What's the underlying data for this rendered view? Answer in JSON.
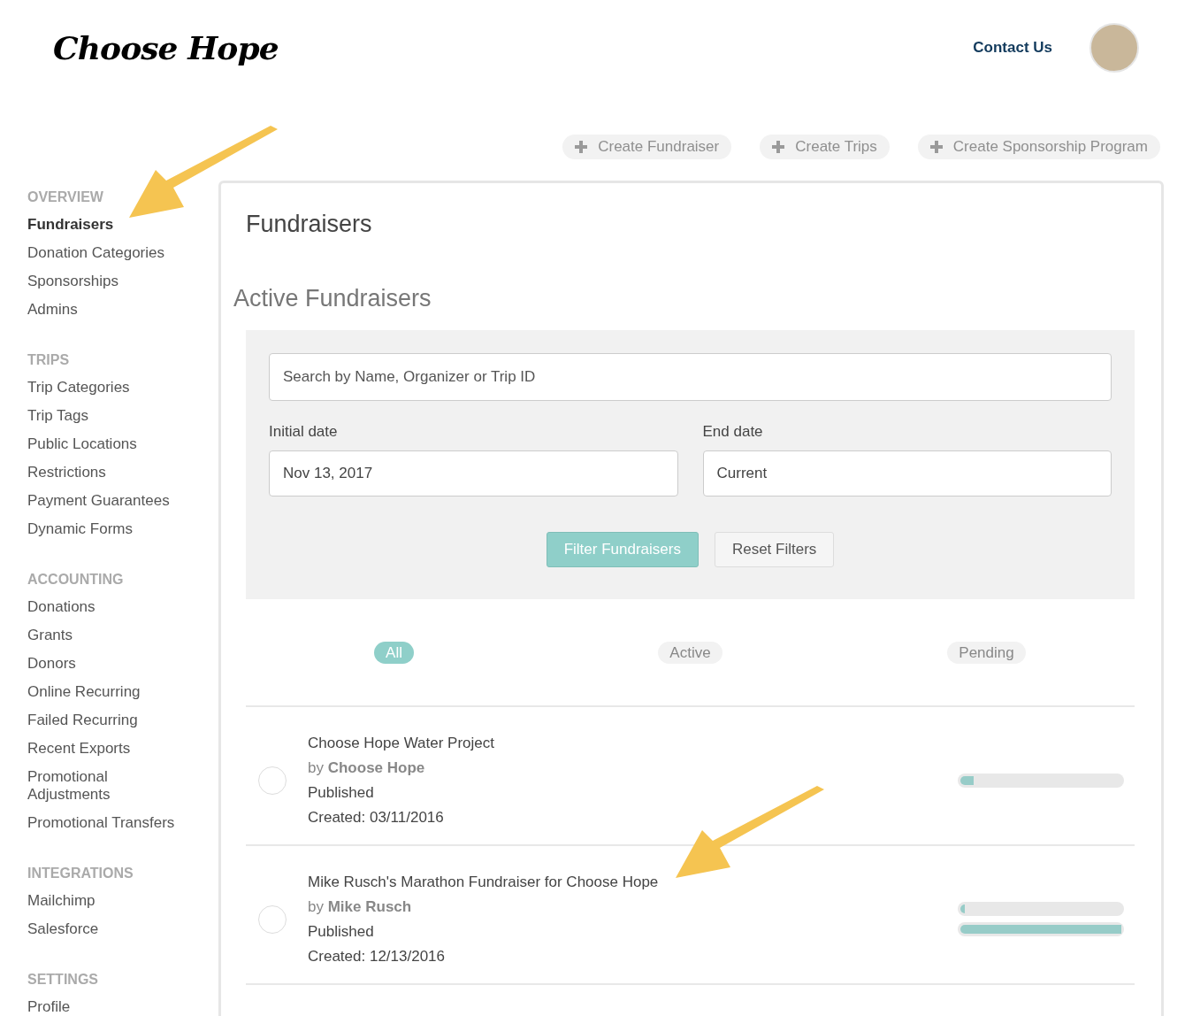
{
  "header": {
    "logo": "Choose Hope",
    "contact_link": "Contact Us"
  },
  "actions": [
    "Create Fundraiser",
    "Create Trips",
    "Create Sponsorship Program"
  ],
  "sidebar": [
    {
      "heading": "OVERVIEW",
      "items": [
        {
          "label": "Fundraisers",
          "selected": true
        },
        {
          "label": "Donation Categories",
          "selected": false
        },
        {
          "label": "Sponsorships",
          "selected": false
        },
        {
          "label": "Admins",
          "selected": false
        }
      ]
    },
    {
      "heading": "TRIPS",
      "items": [
        {
          "label": "Trip Categories",
          "selected": false
        },
        {
          "label": "Trip Tags",
          "selected": false
        },
        {
          "label": "Public Locations",
          "selected": false
        },
        {
          "label": "Restrictions",
          "selected": false
        },
        {
          "label": "Payment Guarantees",
          "selected": false
        },
        {
          "label": "Dynamic Forms",
          "selected": false
        }
      ]
    },
    {
      "heading": "ACCOUNTING",
      "items": [
        {
          "label": "Donations",
          "selected": false
        },
        {
          "label": "Grants",
          "selected": false
        },
        {
          "label": "Donors",
          "selected": false
        },
        {
          "label": "Online Recurring",
          "selected": false
        },
        {
          "label": "Failed Recurring",
          "selected": false
        },
        {
          "label": "Recent Exports",
          "selected": false
        },
        {
          "label": "Promotional Adjustments",
          "selected": false
        },
        {
          "label": "Promotional Transfers",
          "selected": false
        }
      ]
    },
    {
      "heading": "INTEGRATIONS",
      "items": [
        {
          "label": "Mailchimp",
          "selected": false
        },
        {
          "label": "Salesforce",
          "selected": false
        }
      ]
    },
    {
      "heading": "SETTINGS",
      "items": [
        {
          "label": "Profile",
          "selected": false
        }
      ]
    }
  ],
  "page_title": "Fundraisers",
  "section_title": "Active Fundraisers",
  "filters": {
    "search": {
      "placeholder": "Search by Name, Organizer or Trip ID"
    },
    "initial_date": {
      "label": "Initial date",
      "value": "Nov 13, 2017"
    },
    "end_date": {
      "label": "End date",
      "value": "Current"
    },
    "buttons": [
      {
        "label": "Filter Fundraisers",
        "kind": "primary"
      },
      {
        "label": "Reset Filters",
        "kind": "secondary"
      }
    ]
  },
  "status_tabs": [
    {
      "label": "All",
      "selected": true
    },
    {
      "label": "Active",
      "selected": false
    },
    {
      "label": "Pending",
      "selected": false
    }
  ],
  "fundraisers": [
    {
      "title": "Choose Hope Water Project",
      "by": "by",
      "organizer": "Choose Hope",
      "status": "Published",
      "created": "Created: 03/11/2016",
      "bars": [
        {
          "level": 0.08
        }
      ]
    },
    {
      "title": "Mike Rusch's Marathon Fundraiser for Choose Hope",
      "by": "by",
      "organizer": "Mike Rusch",
      "status": "Published",
      "created": "Created: 12/13/2016",
      "bars": [
        {
          "level": 0.03
        },
        {
          "level": 1
        }
      ]
    }
  ]
}
